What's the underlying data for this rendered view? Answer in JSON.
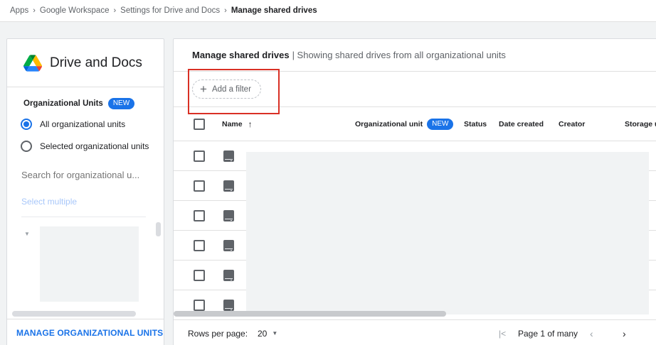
{
  "breadcrumb": [
    {
      "label": "Apps"
    },
    {
      "label": "Google Workspace"
    },
    {
      "label": "Settings for Drive and Docs"
    },
    {
      "label": "Manage shared drives"
    }
  ],
  "breadcrumb_separator": "›",
  "left_panel": {
    "title": "Drive and Docs",
    "ou_section_label": "Organizational Units",
    "new_badge": "NEW",
    "radio_all": "All organizational units",
    "radio_selected": "Selected organizational units",
    "search_placeholder": "Search for organizational u...",
    "select_multiple": "Select multiple",
    "footer_link": "MANAGE ORGANIZATIONAL UNITS"
  },
  "main": {
    "title": "Manage shared drives",
    "subtitle": "| Showing shared drives from all organizational units",
    "add_filter": "Add a filter",
    "columns": {
      "name": "Name",
      "org_unit": "Organizational unit",
      "org_unit_badge": "NEW",
      "status": "Status",
      "date_created": "Date created",
      "creator": "Creator",
      "storage": "Storage u"
    },
    "row_count": 6
  },
  "pagination": {
    "rows_per_page_label": "Rows per page:",
    "rows_per_page_value": "20",
    "page_text": "Page 1 of many"
  },
  "colors": {
    "accent": "#1a73e8",
    "highlight": "#d93025"
  },
  "icons": {
    "breadcrumb_sep": "chevron-right-icon",
    "drive_logo": "google-drive-logo",
    "add_filter": "plus-icon",
    "sort": "arrow-up-icon",
    "row_item": "shared-drive-icon",
    "rows_dropdown": "caret-down-icon",
    "first_page": "first-page-icon",
    "prev_page": "chevron-left-icon",
    "next_page": "chevron-right-icon"
  }
}
